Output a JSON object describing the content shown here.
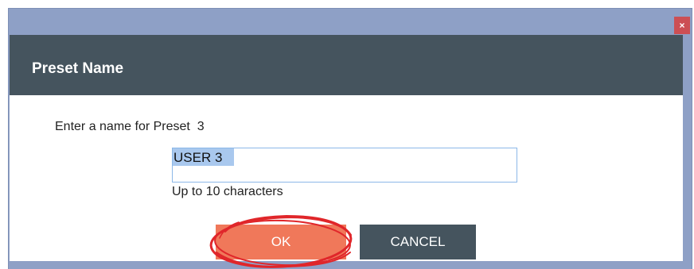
{
  "window": {
    "close_label": "×"
  },
  "dialog": {
    "title": "Preset Name",
    "prompt": "Enter a name for Preset  3",
    "input_value": "USER 3",
    "hint": "Up to 10 characters",
    "ok_label": "OK",
    "cancel_label": "CANCEL"
  },
  "colors": {
    "titlebar": "#8ea0c6",
    "header": "#45545e",
    "ok_button": "#f0785a",
    "cancel_button": "#45545e",
    "close_button": "#cc4f54",
    "annotation_circle": "#e0262a"
  }
}
